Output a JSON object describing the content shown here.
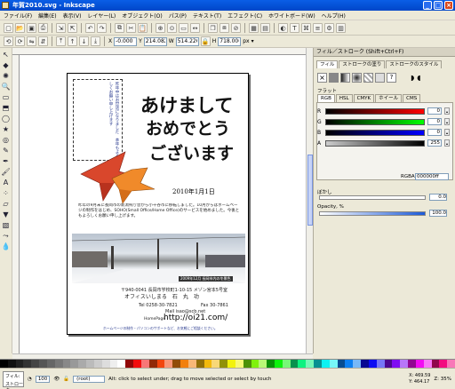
{
  "window": {
    "title": "年賀2010.svg - Inkscape",
    "minimize": "_",
    "maximize": "□",
    "close": "×"
  },
  "menu": [
    "ファイル(F)",
    "編集(E)",
    "表示(V)",
    "レイヤー(L)",
    "オブジェクト(O)",
    "パス(P)",
    "テキスト(T)",
    "エフェクト(C)",
    "ホワイトボード(W)",
    "ヘルプ(H)"
  ],
  "controls": {
    "x_label": "X",
    "x_value": "-0.000",
    "y_label": "Y",
    "y_value": "214.082",
    "w_label": "W",
    "w_value": "514.226",
    "h_label": "H",
    "h_value": "718.000",
    "unit": "px"
  },
  "dock": {
    "header": "フィル／ストローク (Shift+Ctrl+F)",
    "tabs": [
      "フィル",
      "ストロークの塗り",
      "ストロークのスタイル"
    ],
    "section": "フラット",
    "mode_tabs": [
      "RGB",
      "HSL",
      "CMYK",
      "ホイール",
      "CMS"
    ],
    "sliders": [
      {
        "label": "R",
        "value": "0"
      },
      {
        "label": "G",
        "value": "0"
      },
      {
        "label": "B",
        "value": "0"
      },
      {
        "label": "A",
        "value": "255"
      }
    ],
    "rgba_label": "RGBA:",
    "rgba_value": "000000ff",
    "blur_label": "ぼかし",
    "blur_value": "0.0",
    "opacity_label": "Opacity, %",
    "opacity_value": "100.0"
  },
  "page": {
    "heading_line1": "あけまして",
    "heading_line2": "おめでとう",
    "heading_line3": "ございます",
    "date": "2010年1月1日",
    "vertical_note": "昨年中はお世話になりました　本年もよろしくお願い申し上げます",
    "body": "昨年の9月末に長岡市の新潟県庁舎から小千谷市に移転しました。10月からはホームページの制作をはじめ、SOHO(Small Office/Home Office)のサービスを始めました。今後ともよろしくお願い申し上げます。",
    "photo_caption": "2009年12月 長岡市内の冬景色",
    "address": "〒940-0041 長岡市学校町1-10-15 メゾン宮本5号室",
    "office": "オフィスいしまる　石　丸　功",
    "tel": "Tel 0258-30-7821",
    "fax": "Fax 30-7861",
    "mail": "Mail isao@scb.net",
    "homepage_label": "HomePage",
    "url": "http://oi21.com/",
    "footer_note": "ホームページの制作・パソコンのサポートなど、お気軽にご相談ください。"
  },
  "status": {
    "fill_label": "フィル:",
    "stroke_label": "ストローク:",
    "opacity_value": "100",
    "layer": "(root)",
    "message": "Alt: click to select under; drag to move selected or select by touch",
    "x_label": "X:",
    "x_value": "469.59",
    "y_label": "Y:",
    "y_value": "464.17",
    "zoom_label": "Z:",
    "zoom_value": "35%"
  },
  "colors": {
    "titlebar": "#0a5ee6",
    "accent_red": "#d9472c",
    "accent_orange": "#f08a2a",
    "calligraphy": "#111111"
  },
  "icons": {
    "select": "selector-icon",
    "node": "node-icon",
    "zoom": "zoom-icon",
    "rect": "rectangle-icon",
    "ellipse": "ellipse-icon",
    "star": "star-icon",
    "spiral": "spiral-icon",
    "pencil": "pencil-icon",
    "pen": "pen-icon",
    "calligraphy": "calligraphy-icon",
    "text": "text-icon",
    "gradient": "gradient-icon",
    "dropper": "dropper-icon"
  }
}
